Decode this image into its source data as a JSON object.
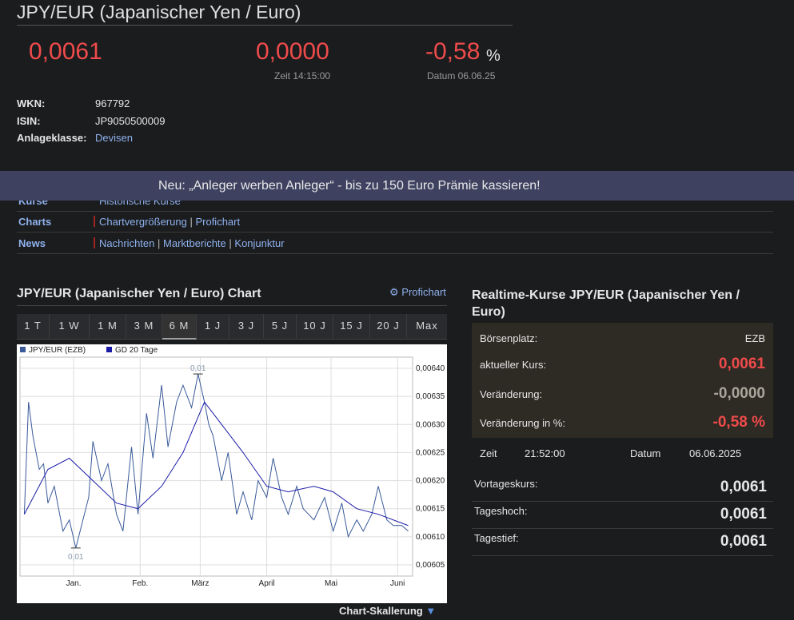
{
  "header": {
    "title": "JPY/EUR (Japanischer Yen / Euro)",
    "price": "0,0061",
    "change": "0,0000",
    "change_pct": "-0,58",
    "pct_sign": "%",
    "time_label": "Zeit 14:15:00",
    "date_label": "Datum 06.06.25"
  },
  "info": {
    "wkn_label": "WKN:",
    "wkn": "967792",
    "isin_label": "ISIN:",
    "isin": "JP9050500009",
    "class_label": "Anlageklasse:",
    "class": "Devisen"
  },
  "banner": "Neu: „Anleger werben Anleger“ - bis zu 150 Euro Prämie kassieren!",
  "nav": {
    "kurse_label": "Kurse",
    "kurse_link": "Historische Kurse",
    "charts_label": "Charts",
    "charts_links": [
      "Chartvergrößerung",
      "Profichart"
    ],
    "news_label": "News",
    "news_links": [
      "Nachrichten",
      "Marktberichte",
      "Konjunktur"
    ],
    "sep": "|"
  },
  "chart_section": {
    "title": "JPY/EUR (Japanischer Yen / Euro) Chart",
    "profichart": "Profichart",
    "tabs": [
      "1 T",
      "1 W",
      "1 M",
      "3 M",
      "6 M",
      "1 J",
      "3 J",
      "5 J",
      "10 J",
      "15 J",
      "20 J",
      "Max"
    ],
    "active_tab": "6 M",
    "scaling": "Chart-Skallerung",
    "scaling_arrow": "▼"
  },
  "chart_data": {
    "type": "line",
    "series": [
      {
        "name": "JPY/EUR (EZB)",
        "color": "#3a5a9a",
        "x": [
          "2024-12-09",
          "2024-12-11",
          "2024-12-13",
          "2024-12-16",
          "2024-12-18",
          "2024-12-20",
          "2024-12-23",
          "2024-12-27",
          "2024-12-30",
          "2025-01-02",
          "2025-01-06",
          "2025-01-08",
          "2025-01-10",
          "2025-01-14",
          "2025-01-17",
          "2025-01-21",
          "2025-01-24",
          "2025-01-28",
          "2025-01-31",
          "2025-02-04",
          "2025-02-07",
          "2025-02-11",
          "2025-02-14",
          "2025-02-18",
          "2025-02-21",
          "2025-02-25",
          "2025-02-28",
          "2025-03-03",
          "2025-03-05",
          "2025-03-07",
          "2025-03-11",
          "2025-03-14",
          "2025-03-18",
          "2025-03-21",
          "2025-03-25",
          "2025-03-28",
          "2025-04-01",
          "2025-04-04",
          "2025-04-08",
          "2025-04-11",
          "2025-04-15",
          "2025-04-18",
          "2025-04-23",
          "2025-04-28",
          "2025-05-02",
          "2025-05-06",
          "2025-05-09",
          "2025-05-13",
          "2025-05-16",
          "2025-05-20",
          "2025-05-23",
          "2025-05-27",
          "2025-05-30",
          "2025-06-03",
          "2025-06-06"
        ],
        "values": [
          0.00614,
          0.00634,
          0.00628,
          0.00622,
          0.00623,
          0.00616,
          0.00619,
          0.00611,
          0.00613,
          0.00608,
          0.00614,
          0.00617,
          0.00627,
          0.0062,
          0.00623,
          0.00614,
          0.00611,
          0.00626,
          0.00614,
          0.00632,
          0.00624,
          0.00637,
          0.00626,
          0.00634,
          0.00637,
          0.00633,
          0.00639,
          0.00634,
          0.0063,
          0.00628,
          0.0062,
          0.00625,
          0.00614,
          0.00618,
          0.00613,
          0.0062,
          0.00617,
          0.00624,
          0.00617,
          0.00614,
          0.00619,
          0.00615,
          0.00613,
          0.00617,
          0.00611,
          0.00616,
          0.0061,
          0.00613,
          0.00611,
          0.00614,
          0.00619,
          0.00613,
          0.00612,
          0.00612,
          0.00611
        ]
      },
      {
        "name": "GD 20 Tage",
        "color": "#1a1aa8",
        "x": [
          "2024-12-09",
          "2024-12-20",
          "2024-12-30",
          "2025-01-10",
          "2025-01-21",
          "2025-01-31",
          "2025-02-11",
          "2025-02-21",
          "2025-03-03",
          "2025-03-11",
          "2025-03-21",
          "2025-04-01",
          "2025-04-11",
          "2025-04-23",
          "2025-05-02",
          "2025-05-13",
          "2025-05-23",
          "2025-06-06"
        ],
        "values": [
          0.00614,
          0.00622,
          0.00624,
          0.0062,
          0.00616,
          0.00615,
          0.00619,
          0.00625,
          0.00634,
          0.0063,
          0.00625,
          0.00619,
          0.00618,
          0.00619,
          0.00618,
          0.00615,
          0.00614,
          0.00612
        ]
      }
    ],
    "xticks": [
      "Jan.",
      "Feb.",
      "März",
      "April",
      "Mai",
      "Juni"
    ],
    "xtick_dates": [
      "2025-01-01",
      "2025-02-01",
      "2025-03-01",
      "2025-04-01",
      "2025-05-01",
      "2025-06-01"
    ],
    "yticks": [
      "0,00605",
      "0,00610",
      "0,00615",
      "0,00620",
      "0,00625",
      "0,00630",
      "0,00635",
      "0,00640"
    ],
    "ylim": [
      0.00603,
      0.00642
    ],
    "annotations": {
      "high": "0,01",
      "low": "0,01"
    },
    "grid": true,
    "legend_position": "top-left"
  },
  "realtime": {
    "title": "Realtime-Kurse JPY/EUR (Japanischer Yen / Euro)",
    "rows": [
      {
        "label": "Börsenplatz:",
        "value": "EZB"
      },
      {
        "label": "aktueller Kurs:",
        "value": "0,0061",
        "color": "#f04b4b"
      },
      {
        "label": "Veränderung:",
        "value": "-0,0000",
        "color": "#aaa69b"
      },
      {
        "label": "Veränderung in %:",
        "value": "-0,58 %",
        "color": "#f04b4b"
      }
    ],
    "zeit_label": "Zeit",
    "zeit": "21:52:00",
    "datum_label": "Datum",
    "datum": "06.06.2025",
    "low_rows": [
      {
        "label": "Vortageskurs:",
        "value": "0,0061"
      },
      {
        "label": "Tageshoch:",
        "value": "0,0061"
      },
      {
        "label": "Tagestief:",
        "value": "0,0061"
      }
    ]
  }
}
